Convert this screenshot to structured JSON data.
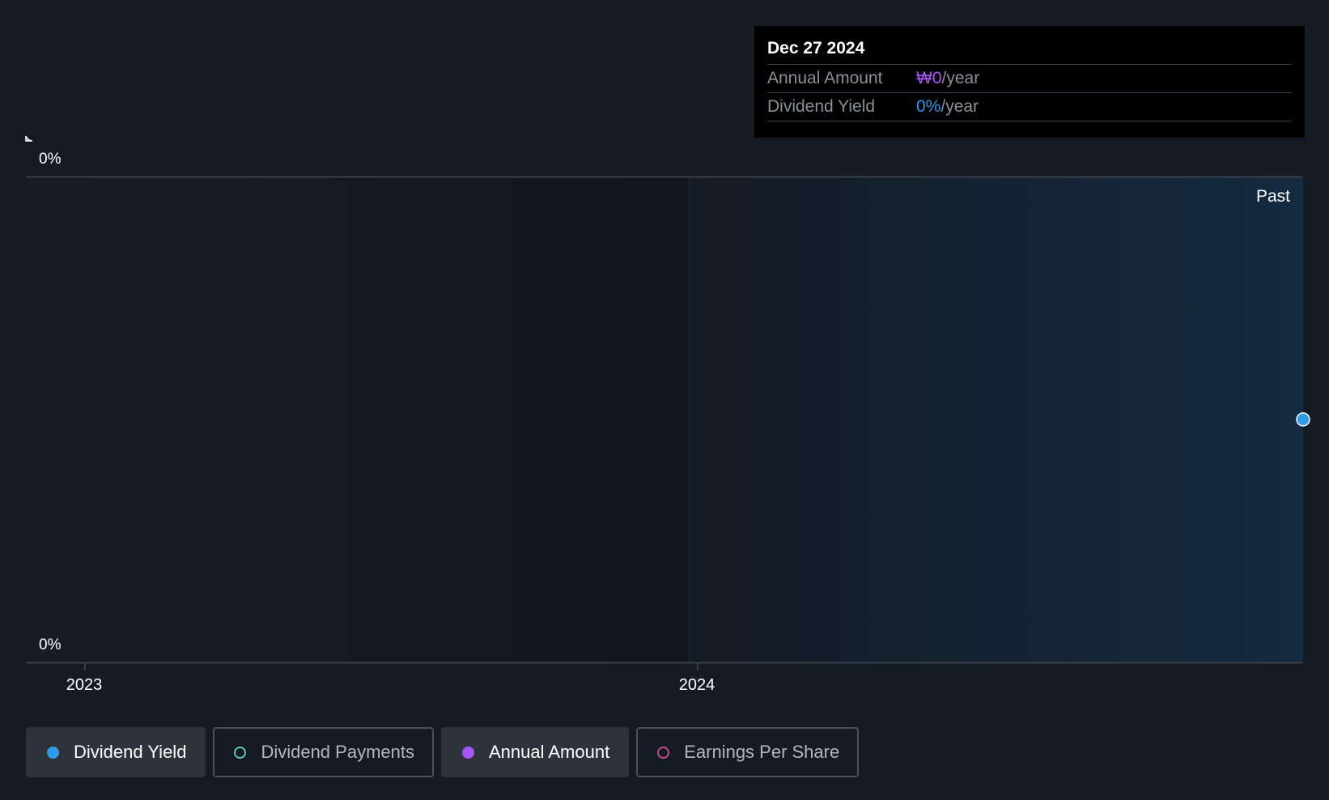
{
  "chart_data": {
    "type": "line",
    "region_label": "Past",
    "y_axis_ticks": [
      "0%",
      "0%"
    ],
    "x_axis_ticks": [
      "2023",
      "2024"
    ],
    "x_range": [
      "2022-11-01",
      "2024-12-27"
    ],
    "series": [
      {
        "name": "Dividend Yield",
        "values": [
          0
        ]
      },
      {
        "name": "Annual Amount",
        "values": [
          0
        ]
      }
    ]
  },
  "tooltip": {
    "date": "Dec 27 2024",
    "rows": [
      {
        "label": "Annual Amount",
        "value": "₩0",
        "unit": "/year"
      },
      {
        "label": "Dividend Yield",
        "value": "0%",
        "unit": "/year"
      }
    ]
  },
  "legend": [
    {
      "label": "Dividend Yield",
      "active": true,
      "color": "#2f9ae8"
    },
    {
      "label": "Dividend Payments",
      "active": false,
      "color": "#5ec7bd"
    },
    {
      "label": "Annual Amount",
      "active": true,
      "color": "#a855f7"
    },
    {
      "label": "Earnings Per Share",
      "active": false,
      "color": "#c24b86"
    }
  ],
  "colors": {
    "background": "#151b24",
    "past_region": "#132a40",
    "axis": "#3a4049",
    "dividend_yield": "#2f9ae8",
    "annual_amount": "#a855f7"
  }
}
